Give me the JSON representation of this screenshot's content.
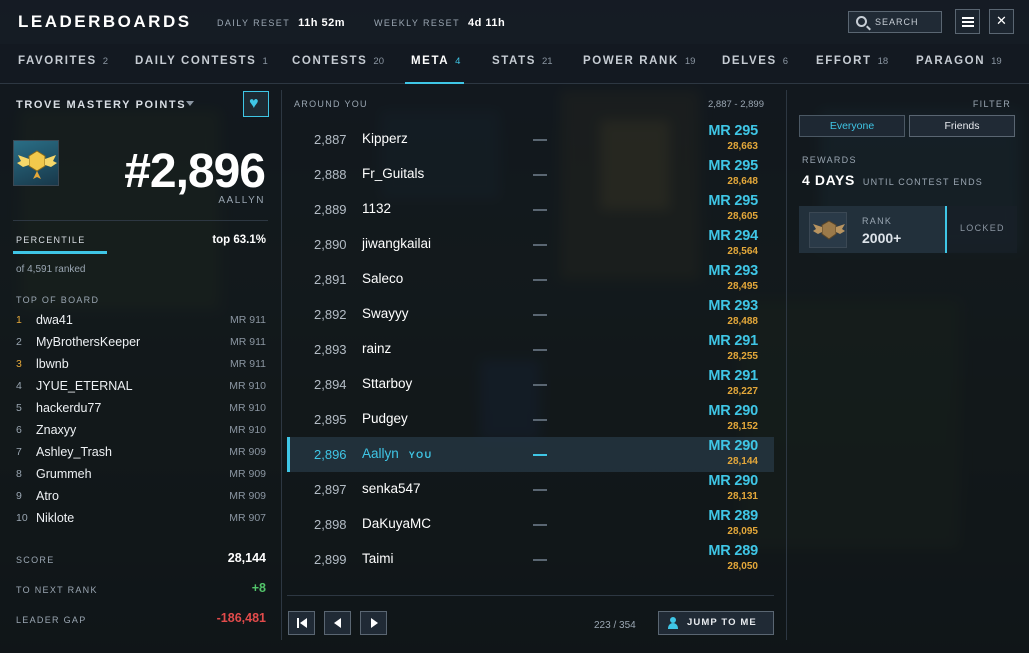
{
  "header": {
    "title": "LEADERBOARDS",
    "daily_reset_label": "DAILY RESET",
    "daily_reset_value": "11h 52m",
    "weekly_reset_label": "WEEKLY RESET",
    "weekly_reset_value": "4d 11h",
    "search_label": "SEARCH",
    "close_glyph": "✕"
  },
  "tabs": [
    {
      "label": "FAVORITES",
      "count": "2"
    },
    {
      "label": "DAILY CONTESTS",
      "count": "1"
    },
    {
      "label": "CONTESTS",
      "count": "20"
    },
    {
      "label": "META",
      "count": "4"
    },
    {
      "label": "STATS",
      "count": "21"
    },
    {
      "label": "POWER RANK",
      "count": "19"
    },
    {
      "label": "DELVES",
      "count": "6"
    },
    {
      "label": "EFFORT",
      "count": "18"
    },
    {
      "label": "PARAGON",
      "count": "19"
    }
  ],
  "active_tab": "META",
  "left": {
    "board_title": "TROVE MASTERY POINTS",
    "heart_glyph": "♥",
    "rank": "#2,896",
    "player": "AALLYN",
    "percentile_label": "PERCENTILE",
    "percentile_value": "top 63.1%",
    "percentile_fill": 0.369,
    "ranked_text": "of 4,591 ranked",
    "top_label": "TOP OF BOARD",
    "top": [
      {
        "n": "1",
        "name": "dwa41",
        "mr": "MR 911"
      },
      {
        "n": "2",
        "name": "MyBrothersKeeper",
        "mr": "MR 911"
      },
      {
        "n": "3",
        "name": "lbwnb",
        "mr": "MR 911"
      },
      {
        "n": "4",
        "name": "JYUE_ETERNAL",
        "mr": "MR 910"
      },
      {
        "n": "5",
        "name": "hackerdu77",
        "mr": "MR 910"
      },
      {
        "n": "6",
        "name": "Znaxyy",
        "mr": "MR 910"
      },
      {
        "n": "7",
        "name": "Ashley_Trash",
        "mr": "MR 909"
      },
      {
        "n": "8",
        "name": "Grummeh",
        "mr": "MR 909"
      },
      {
        "n": "9",
        "name": "Atro",
        "mr": "MR 909"
      },
      {
        "n": "10",
        "name": "Niklote",
        "mr": "MR 907"
      }
    ],
    "score_label": "SCORE",
    "score_value": "28,144",
    "next_label": "TO NEXT RANK",
    "next_value": "+8",
    "gap_label": "LEADER GAP",
    "gap_value": "-186,481"
  },
  "center": {
    "around_label": "AROUND YOU",
    "range": "2,887 - 2,899",
    "you_tag": "YOU",
    "rows": [
      {
        "rank": "2,887",
        "name": "Kipperz",
        "mr": "MR 295",
        "score": "28,663"
      },
      {
        "rank": "2,888",
        "name": "Fr_Guitals",
        "mr": "MR 295",
        "score": "28,648"
      },
      {
        "rank": "2,889",
        "name": "1132",
        "mr": "MR 295",
        "score": "28,605"
      },
      {
        "rank": "2,890",
        "name": "jiwangkailai",
        "mr": "MR 294",
        "score": "28,564"
      },
      {
        "rank": "2,891",
        "name": "Saleco",
        "mr": "MR 293",
        "score": "28,495"
      },
      {
        "rank": "2,892",
        "name": "Swayyy",
        "mr": "MR 293",
        "score": "28,488"
      },
      {
        "rank": "2,893",
        "name": "rainz",
        "mr": "MR 291",
        "score": "28,255"
      },
      {
        "rank": "2,894",
        "name": "Sttarboy",
        "mr": "MR 291",
        "score": "28,227"
      },
      {
        "rank": "2,895",
        "name": "Pudgey",
        "mr": "MR 290",
        "score": "28,152"
      },
      {
        "rank": "2,896",
        "name": "Aallyn",
        "mr": "MR 290",
        "score": "28,144",
        "me": true
      },
      {
        "rank": "2,897",
        "name": "senka547",
        "mr": "MR 290",
        "score": "28,131"
      },
      {
        "rank": "2,898",
        "name": "DaKuyaMC",
        "mr": "MR 289",
        "score": "28,095"
      },
      {
        "rank": "2,899",
        "name": "Taimi",
        "mr": "MR 289",
        "score": "28,050"
      }
    ],
    "page": "223 / 354",
    "jump_label": "JUMP TO ME"
  },
  "right": {
    "filter_label": "FILTER",
    "filter_everyone": "Everyone",
    "filter_friends": "Friends",
    "rewards_label": "REWARDS",
    "days": "4 DAYS",
    "until": "UNTIL CONTEST ENDS",
    "rank_label": "RANK",
    "rank_value": "2000+",
    "locked": "LOCKED"
  },
  "colors": {
    "accent": "#3fc6e6",
    "gold": "#e4a83a",
    "positive": "#52c46a",
    "negative": "#e24b4b"
  }
}
